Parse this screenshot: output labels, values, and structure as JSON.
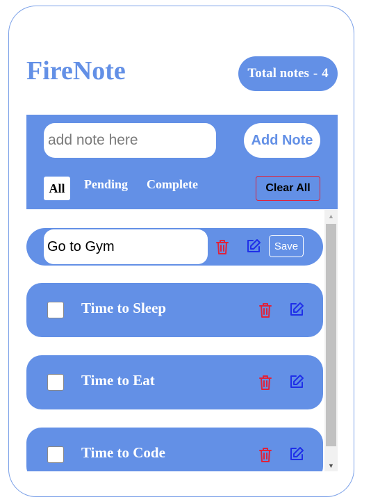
{
  "app": {
    "title": "FireNote",
    "total_label": "Total notes",
    "total_separator": "-",
    "total_count": "4"
  },
  "composer": {
    "placeholder": "add note here",
    "add_button": "Add Note"
  },
  "filters": {
    "all": "All",
    "pending": "Pending",
    "complete": "Complete",
    "active": "All"
  },
  "clear_all": "Clear All",
  "editing_note": {
    "value": "Go to Gym",
    "save_label": "Save"
  },
  "notes": [
    {
      "text": "Time to Sleep",
      "checked": false
    },
    {
      "text": "Time to Eat",
      "checked": false
    },
    {
      "text": "Time to Code",
      "checked": false
    }
  ],
  "icons": {
    "delete": "trash-icon",
    "edit": "edit-icon"
  },
  "colors": {
    "accent": "#6390e6",
    "delete": "#e0223a",
    "edit": "#1f2fe8",
    "white": "#ffffff"
  }
}
